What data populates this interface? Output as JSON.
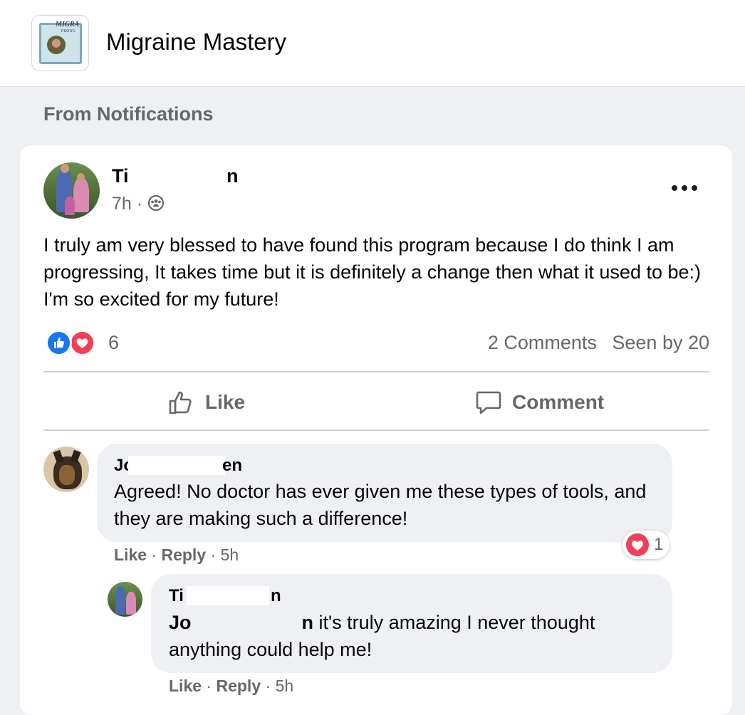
{
  "group": {
    "name": "Migraine Mastery",
    "thumb_text_1": "MIGRA",
    "thumb_text_2": "TAKING"
  },
  "section_label": "From Notifications",
  "post": {
    "author_first": "Ti",
    "author_last": "n",
    "time": "7h",
    "audience_icon": "group-members-icon",
    "text": "I truly am very blessed to have found this program because I do think I am progressing, It takes time but it is definitely a change then what it used to be:) I'm so excited for my future!",
    "reaction_count": "6",
    "comments_count": "2 Comments",
    "seen_by": "Seen by 20",
    "like_label": "Like",
    "comment_label": "Comment"
  },
  "comments": [
    {
      "author_first": "Jo",
      "author_last": "en",
      "text": "Agreed! No doctor has ever given me these types of tools, and they are making such a difference!",
      "like": "Like",
      "reply": "Reply",
      "time": "5h",
      "reaction_count": "1"
    },
    {
      "author_first": "Ti",
      "author_last": "n",
      "mention_first": "Jo",
      "mention_last": "n",
      "text": " it's truly amazing I never thought anything could help me!",
      "like": "Like",
      "reply": "Reply",
      "time": "5h"
    }
  ],
  "colors": {
    "like_blue": "#1877f2",
    "love_red": "#f33e58",
    "secondary_text": "#65676b",
    "page_bg": "#eff0f3"
  }
}
